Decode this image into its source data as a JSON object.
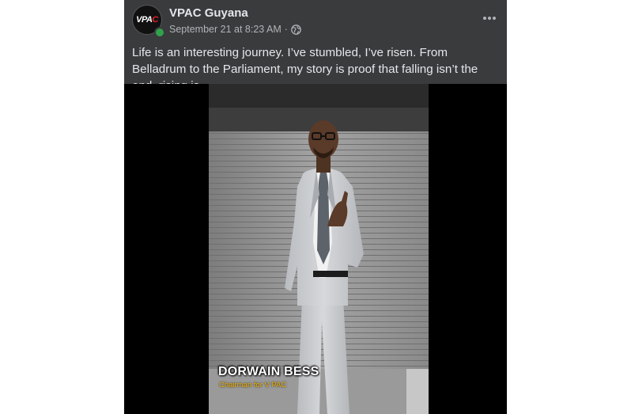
{
  "post": {
    "page_name": "VPAC Guyana",
    "timestamp": "September 21 at 8:23 AM",
    "separator": "·",
    "privacy_icon": "globe-icon",
    "more_icon": "more-options-icon",
    "caption": "Life is an interesting journey. I’ve stumbled, I’ve risen. From Belladrum to the Parliament, my story is proof that falling isn’t the end, rising is."
  },
  "avatar": {
    "text_main": "VPA",
    "text_accent": "C",
    "online": true
  },
  "video": {
    "overlay_name": "DORWAIN BESS",
    "overlay_title": "Chairman for V PAC"
  },
  "colors": {
    "post_background": "#3a3b3c",
    "primary_text": "#e4e6eb",
    "secondary_text": "#b0b3b8",
    "online_green": "#31a24c",
    "overlay_title": "#f5b400"
  }
}
